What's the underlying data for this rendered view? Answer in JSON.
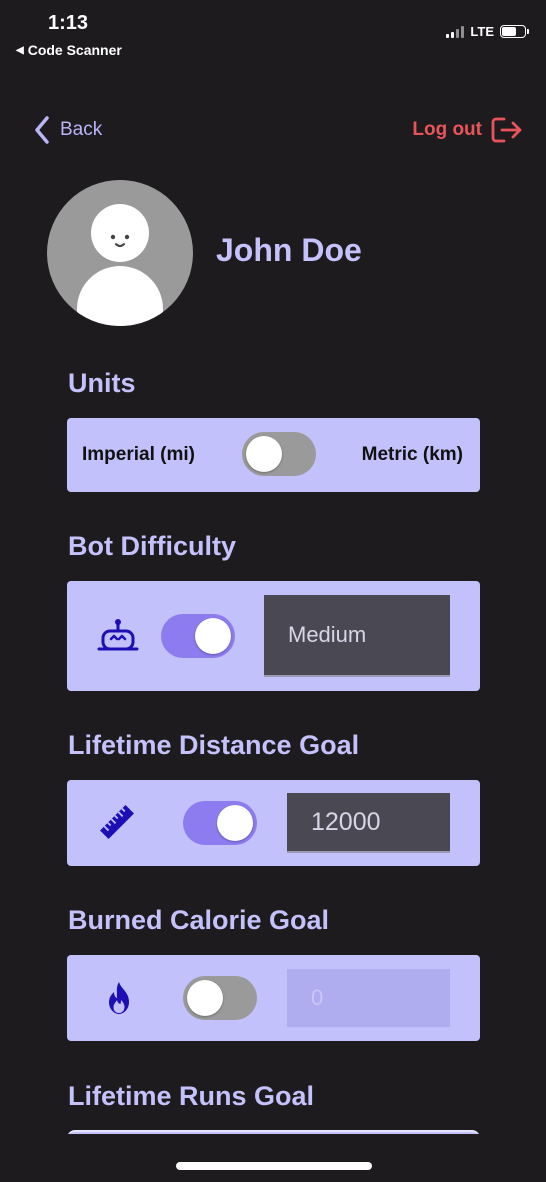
{
  "status_bar": {
    "time": "1:13",
    "back_app": "Code Scanner",
    "network": "LTE"
  },
  "nav": {
    "back_label": "Back",
    "logout_label": "Log out",
    "accent_color": "#b9b5f6",
    "logout_color": "#e9545a"
  },
  "profile": {
    "name": "John Doe"
  },
  "units": {
    "title": "Units",
    "imperial_label": "Imperial (mi)",
    "metric_label": "Metric (km)",
    "toggle_on": false
  },
  "bot_difficulty": {
    "title": "Bot Difficulty",
    "icon": "robot-icon",
    "toggle_on": true,
    "value": "Medium"
  },
  "distance_goal": {
    "title": "Lifetime Distance Goal",
    "icon": "ruler-icon",
    "toggle_on": true,
    "value": "12000"
  },
  "calorie_goal": {
    "title": "Burned Calorie Goal",
    "icon": "flame-icon",
    "toggle_on": false,
    "value": "0"
  },
  "runs_goal": {
    "title": "Lifetime Runs Goal"
  }
}
